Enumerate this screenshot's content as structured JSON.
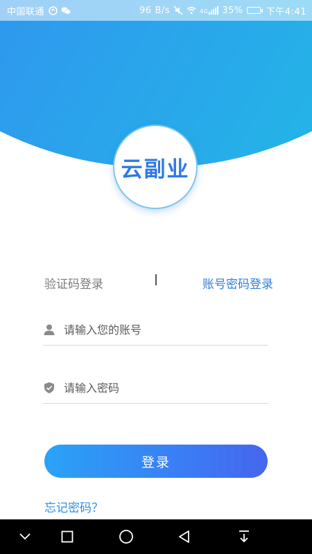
{
  "status_bar": {
    "carrier": "中国联通",
    "speed_value": "96",
    "speed_unit": "B/s",
    "network": "4G",
    "battery": "35%",
    "battery_level": 0.35,
    "time": "下午4:41"
  },
  "logo": {
    "text": "云副业"
  },
  "login_modes": {
    "sms": "验证码登录",
    "password": "账号密码登录",
    "active": "password"
  },
  "form": {
    "account_placeholder": "请输入您的账号",
    "password_placeholder": "请输入密码",
    "login_label": "登录",
    "forgot_label": "忘记密码？"
  },
  "nav_bar": {
    "icons": [
      "chevron-down-icon",
      "square-icon",
      "circle-home-icon",
      "triangle-back-icon",
      "notification-pull-icon"
    ]
  },
  "colors": {
    "accent": "#2f7fd9",
    "gradient_start": "#3f7bf5",
    "gradient_end": "#1ec2e4",
    "button_start": "#2aa3f7",
    "button_end": "#4566ee"
  }
}
